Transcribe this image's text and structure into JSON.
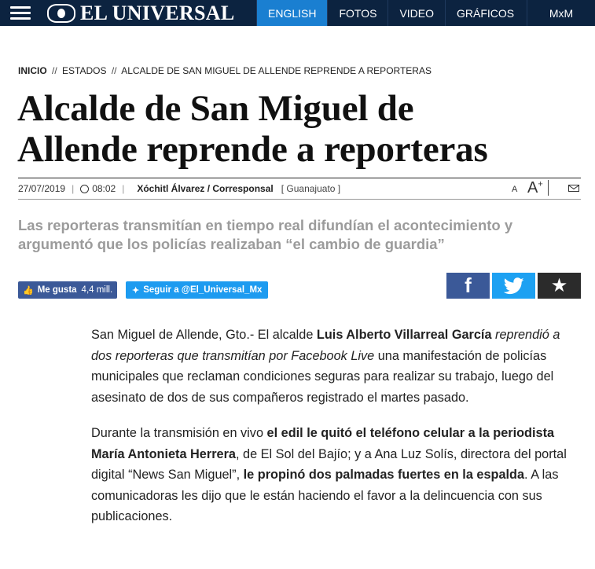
{
  "header": {
    "logo_text": "EL UNIVERSAL",
    "nav": [
      {
        "label": "ENGLISH",
        "active": true
      },
      {
        "label": "FOTOS",
        "active": false
      },
      {
        "label": "VIDEO",
        "active": false
      },
      {
        "label": "GRÁFICOS",
        "active": false
      }
    ],
    "mxm": "MxM",
    "colors": {
      "bar": "#0c2340",
      "active": "#1a7fd1"
    }
  },
  "breadcrumb": {
    "home": "INICIO",
    "section": "ESTADOS",
    "current": "ALCALDE DE SAN MIGUEL DE ALLENDE REPRENDE A REPORTERAS",
    "separator": "//"
  },
  "article": {
    "title_line1": "Alcalde de San Miguel de",
    "title_line2": "Allende reprende a reporteras",
    "date": "27/07/2019",
    "time": "08:02",
    "author": "Xóchitl Álvarez / Corresponsal",
    "location": "[ Guanajuato ]",
    "font_small": "A",
    "font_big": "A",
    "font_big_plus": "+",
    "summary": "Las reporteras transmitían en tiempo real difundían el acontecimiento y argumentó que los policías realizaban “el cambio de guardia”",
    "p1": {
      "a": "San Miguel de Allende, Gto.- El alcalde ",
      "b_bold": "Luis Alberto Villarreal García",
      "c": " ",
      "d_italic": "reprendió a dos reporteras que transmitían por Facebook Live",
      "e": " una manifestación de policías municipales que reclaman condiciones seguras para realizar su trabajo, luego del asesinato de dos de sus compañeros registrado el martes pasado."
    },
    "p2": {
      "a": "Durante la transmisión en vivo ",
      "b_bold": "el edil le quitó el teléfono celular a la periodista María Antonieta Herrera",
      "c": ", de El Sol del Bajío; y a Ana Luz Solís, directora del portal digital “News San Miguel”, ",
      "d_bold": "le propinó dos palmadas fuertes en la espalda",
      "e": ". A las comunicadoras les dijo que le están haciendo el favor a la delincuencia con sus publicaciones."
    }
  },
  "social": {
    "like_label": "Me gusta",
    "like_count": "4,4 mill.",
    "follow_label": "Seguir a @El_Universal_Mx",
    "share_fb": "f",
    "colors": {
      "facebook": "#3b5998",
      "twitter": "#1da1f2",
      "fav": "#2b2b2b"
    }
  }
}
